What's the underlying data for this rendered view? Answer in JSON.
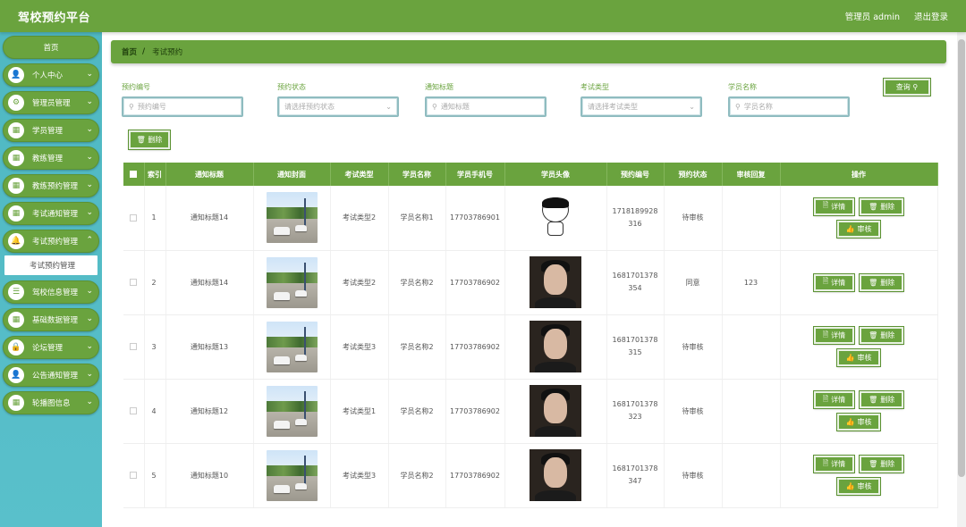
{
  "app": {
    "title": "驾校预约平台"
  },
  "header": {
    "user_label": "管理员 admin",
    "logout_label": "退出登录"
  },
  "sidebar": {
    "home": "首页",
    "items": [
      {
        "label": "个人中心",
        "icon": "person-icon"
      },
      {
        "label": "管理员管理",
        "icon": "gear-icon"
      },
      {
        "label": "学员管理",
        "icon": "grid-icon"
      },
      {
        "label": "教练管理",
        "icon": "grid-icon"
      },
      {
        "label": "教练预约管理",
        "icon": "grid-icon"
      },
      {
        "label": "考试通知管理",
        "icon": "grid-icon"
      },
      {
        "label": "考试预约管理",
        "icon": "bell-icon",
        "expanded": true,
        "sub": "考试预约管理"
      },
      {
        "label": "驾校信息管理",
        "icon": "list-icon"
      },
      {
        "label": "基础数据管理",
        "icon": "grid-icon"
      },
      {
        "label": "论坛管理",
        "icon": "lock-icon"
      },
      {
        "label": "公告通知管理",
        "icon": "person-icon"
      },
      {
        "label": "轮播图信息",
        "icon": "grid-icon"
      }
    ]
  },
  "breadcrumb": {
    "home": "首页",
    "sep": "/",
    "current": "考试预约"
  },
  "filters": [
    {
      "label": "预约编号",
      "placeholder": "预约编号",
      "type": "text"
    },
    {
      "label": "预约状态",
      "placeholder": "请选择预约状态",
      "type": "select"
    },
    {
      "label": "通知标题",
      "placeholder": "通知标题",
      "type": "text"
    },
    {
      "label": "考试类型",
      "placeholder": "请选择考试类型",
      "type": "select"
    },
    {
      "label": "学员名称",
      "placeholder": "学员名称",
      "type": "text"
    }
  ],
  "buttons": {
    "search": "查询",
    "delete": "删除"
  },
  "table": {
    "headers": [
      "索引",
      "通知标题",
      "通知封面",
      "考试类型",
      "学员名称",
      "学员手机号",
      "学员头像",
      "预约编号",
      "预约状态",
      "审核回复",
      "操作"
    ],
    "ops": {
      "detail": "详情",
      "delete": "删除",
      "review": "审核"
    },
    "rows": [
      {
        "index": "1",
        "title": "通知标题14",
        "type": "考试类型2",
        "student": "学员名称1",
        "phone": "17703786901",
        "avatar": "cartoon",
        "code": "1718189928316",
        "status": "待审核",
        "reply": "",
        "review": true
      },
      {
        "index": "2",
        "title": "通知标题14",
        "type": "考试类型2",
        "student": "学员名称2",
        "phone": "17703786902",
        "avatar": "photo",
        "code": "1681701378354",
        "status": "同意",
        "reply": "123",
        "review": false
      },
      {
        "index": "3",
        "title": "通知标题13",
        "type": "考试类型3",
        "student": "学员名称2",
        "phone": "17703786902",
        "avatar": "photo",
        "code": "1681701378315",
        "status": "待审核",
        "reply": "",
        "review": true
      },
      {
        "index": "4",
        "title": "通知标题12",
        "type": "考试类型1",
        "student": "学员名称2",
        "phone": "17703786902",
        "avatar": "photo",
        "code": "1681701378323",
        "status": "待审核",
        "reply": "",
        "review": true
      },
      {
        "index": "5",
        "title": "通知标题10",
        "type": "考试类型3",
        "student": "学员名称2",
        "phone": "17703786902",
        "avatar": "photo",
        "code": "1681701378347",
        "status": "待审核",
        "reply": "",
        "review": true
      }
    ]
  }
}
